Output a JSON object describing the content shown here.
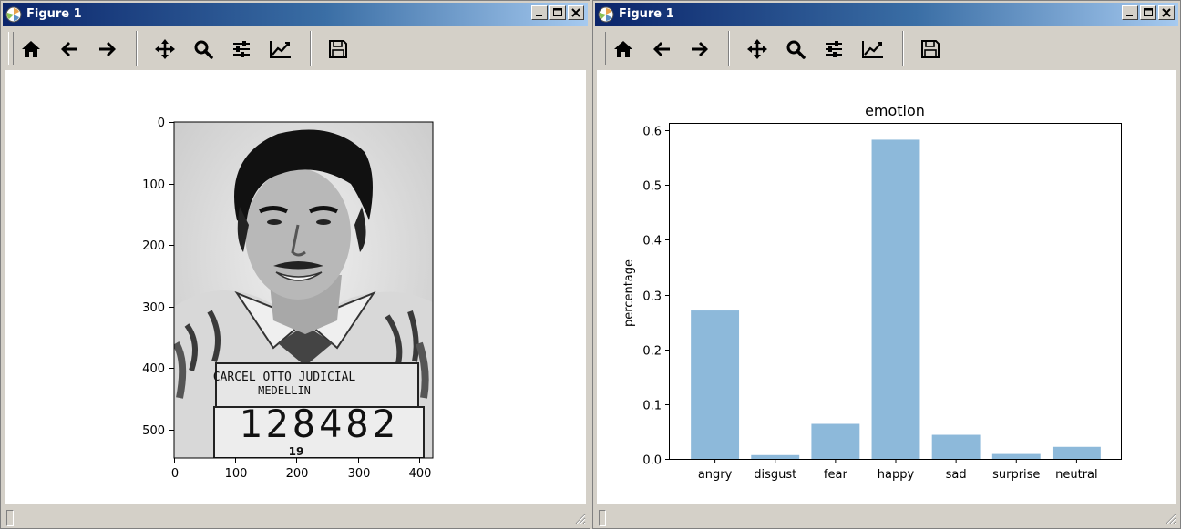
{
  "windows": [
    {
      "title": "Figure 1",
      "toolbar": [
        "home-icon",
        "back-arrow-icon",
        "forward-arrow-icon",
        "pan-move-icon",
        "zoom-magnifier-icon",
        "configure-subplots-icon",
        "edit-axes-icon",
        "save-floppy-icon"
      ],
      "image_axes": {
        "y_ticks": [
          "0",
          "100",
          "200",
          "300",
          "400",
          "500"
        ],
        "x_ticks": [
          "0",
          "100",
          "200",
          "300",
          "400"
        ],
        "photo": {
          "placard_line1": "CARCEL OTTO JUDICIAL",
          "placard_line2": "MEDELLIN",
          "placard_number": "128482",
          "placard_year": "19"
        }
      }
    },
    {
      "title": "Figure 1",
      "toolbar": [
        "home-icon",
        "back-arrow-icon",
        "forward-arrow-icon",
        "pan-move-icon",
        "zoom-magnifier-icon",
        "configure-subplots-icon",
        "edit-axes-icon",
        "save-floppy-icon"
      ]
    }
  ],
  "chart_data": {
    "type": "bar",
    "title": "emotion",
    "xlabel": "",
    "ylabel": "percentage",
    "categories": [
      "angry",
      "disgust",
      "fear",
      "happy",
      "sad",
      "surprise",
      "neutral"
    ],
    "values": [
      0.271,
      0.007,
      0.064,
      0.583,
      0.044,
      0.009,
      0.022
    ],
    "ylim": [
      0,
      0.612
    ],
    "y_ticks": [
      0.0,
      0.1,
      0.2,
      0.3,
      0.4,
      0.5,
      0.6
    ],
    "y_tick_labels": [
      "0.0",
      "0.1",
      "0.2",
      "0.3",
      "0.4",
      "0.5",
      "0.6"
    ],
    "bar_color": "#8db9da",
    "grid": false
  }
}
